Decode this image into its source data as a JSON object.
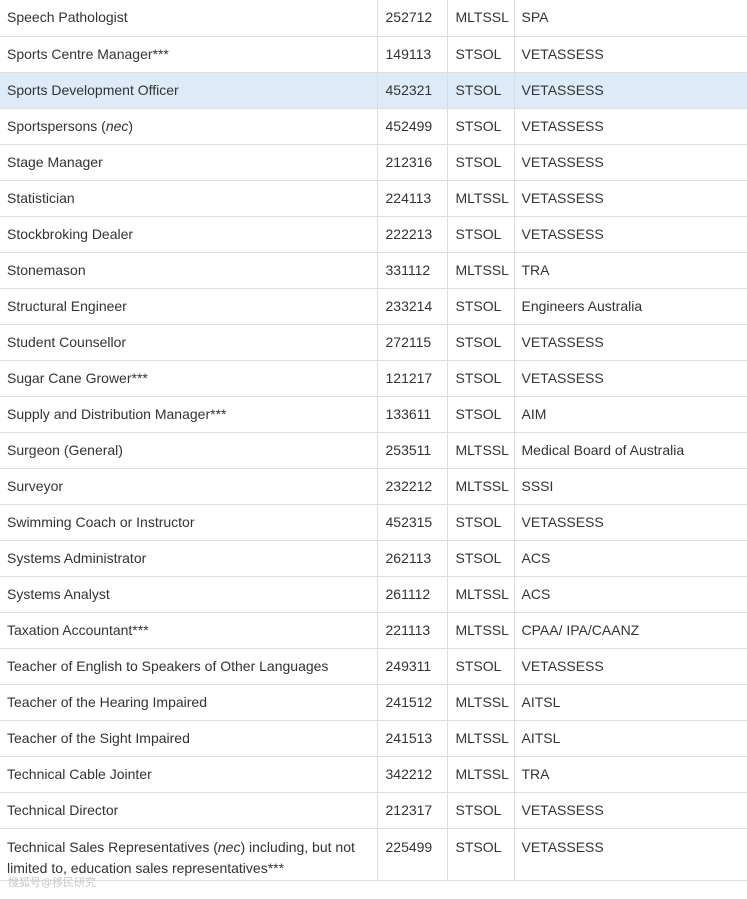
{
  "rows": [
    {
      "name": "Speech Pathologist",
      "code": "252712",
      "list": "MLTSSL",
      "authority": "SPA"
    },
    {
      "name": "Sports Centre Manager***",
      "code": "149113",
      "list": "STSOL",
      "authority": "VETASSESS"
    },
    {
      "name": "Sports Development Officer",
      "code": "452321",
      "list": "STSOL",
      "authority": "VETASSESS",
      "highlighted": true
    },
    {
      "name_pre": "Sportspersons (",
      "name_em": "nec",
      "name_post": ")",
      "code": "452499",
      "list": "STSOL",
      "authority": "VETASSESS"
    },
    {
      "name": "Stage Manager",
      "code": "212316",
      "list": "STSOL",
      "authority": "VETASSESS"
    },
    {
      "name": "Statistician",
      "code": "224113",
      "list": "MLTSSL",
      "authority": "VETASSESS"
    },
    {
      "name": "Stockbroking Dealer",
      "code": "222213",
      "list": "STSOL",
      "authority": "VETASSESS"
    },
    {
      "name": "Stonemason",
      "code": "331112",
      "list": "MLTSSL",
      "authority": "TRA"
    },
    {
      "name": "Structural Engineer",
      "code": "233214",
      "list": "STSOL",
      "authority": "Engineers Australia"
    },
    {
      "name": "Student Counsellor",
      "code": "272115",
      "list": "STSOL",
      "authority": "VETASSESS"
    },
    {
      "name": "Sugar Cane Grower***",
      "code": "121217",
      "list": "STSOL",
      "authority": "VETASSESS"
    },
    {
      "name": "Supply and Distribution Manager***",
      "code": "133611",
      "list": "STSOL",
      "authority": "AIM"
    },
    {
      "name": "Surgeon (General)",
      "code": "253511",
      "list": "MLTSSL",
      "authority": "Medical Board of Australia"
    },
    {
      "name": "Surveyor",
      "code": "232212",
      "list": "MLTSSL",
      "authority": "SSSI"
    },
    {
      "name": "Swimming Coach or Instructor",
      "code": "452315",
      "list": "STSOL",
      "authority": "VETASSESS"
    },
    {
      "name": "Systems Administrator",
      "code": "262113",
      "list": "STSOL",
      "authority": "ACS"
    },
    {
      "name": "Systems Analyst",
      "code": "261112",
      "list": "MLTSSL",
      "authority": "ACS"
    },
    {
      "name": "Taxation Accountant***",
      "code": "221113",
      "list": "MLTSSL",
      "authority": "CPAA/ IPA/CAANZ"
    },
    {
      "name": "Teacher of English to Speakers of Other Languages",
      "code": "249311",
      "list": "STSOL",
      "authority": "VETASSESS"
    },
    {
      "name": "Teacher of the Hearing Impaired",
      "code": "241512",
      "list": "MLTSSL",
      "authority": "AITSL"
    },
    {
      "name": "Teacher of the Sight Impaired",
      "code": "241513",
      "list": "MLTSSL",
      "authority": "AITSL"
    },
    {
      "name": "Technical Cable Jointer",
      "code": "342212",
      "list": "MLTSSL",
      "authority": "TRA"
    },
    {
      "name": "Technical Director",
      "code": "212317",
      "list": "STSOL",
      "authority": "VETASSESS"
    },
    {
      "name_pre": "Technical Sales Representatives (",
      "name_em": "nec",
      "name_post": ") including, but not limited to, education sales representatives***",
      "code": "225499",
      "list": "STSOL",
      "authority": "VETASSESS"
    }
  ],
  "watermark": "搜狐号@移民研究"
}
